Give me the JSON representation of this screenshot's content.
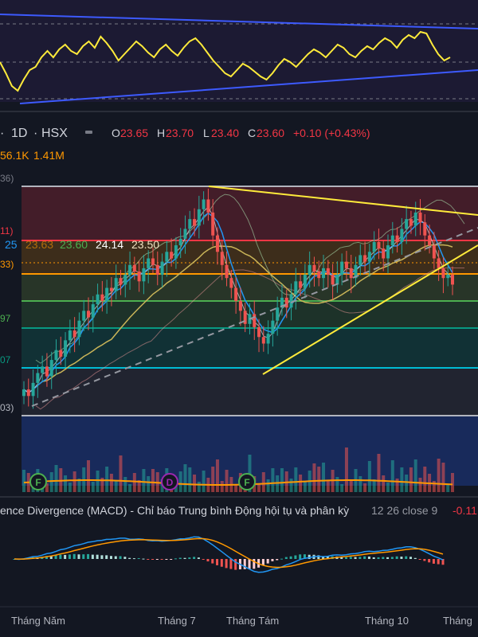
{
  "colors": {
    "background": "#131722",
    "rsi_line": "#ffeb3b",
    "trend_blue": "#3d5afe",
    "candle_up": "#26a69a",
    "candle_down": "#ef5350",
    "macd_line": "#2196f3",
    "signal_line": "#ff9800",
    "fib_top": "#b2b5be",
    "fib_red": "#f23645",
    "fib_orange": "#ff9800",
    "fib_yellow": "#ffeb3b",
    "fib_green": "#4caf50",
    "fib_teal": "#089981",
    "fib_cyan": "#00bcd4"
  },
  "header": {
    "interval": "1D",
    "exchange": "HSX",
    "separator": "·",
    "o_label": "O",
    "o_value": "23.65",
    "h_label": "H",
    "h_value": "23.70",
    "l_label": "L",
    "l_value": "23.40",
    "c_label": "C",
    "c_value": "23.60",
    "change": "+0.10 (+0.43%)",
    "vol1": "56.1K",
    "vol2": "1.41M"
  },
  "ma_values": {
    "v1": "25",
    "v2": "23.63",
    "v3": "23.60",
    "v4": "24.14",
    "v5": "23.50"
  },
  "left_price_labels": {
    "p1": "36)",
    "p2": "11)",
    "p3": "33)",
    "p4": "97",
    "p5": "07",
    "p6": "03)"
  },
  "events": [
    "F",
    "D",
    "F"
  ],
  "macd_title": "ence Divergence (MACD) - Chỉ báo Trung bình Động hội tụ và phân kỳ",
  "macd_params": "12 26 close 9",
  "macd_value": "-0.11",
  "x_labels": [
    "Tháng Năm",
    "Tháng 7",
    "Tháng Tám",
    "Tháng 10",
    "Tháng"
  ],
  "chart_data": {
    "type": "candlestick",
    "title": "",
    "exchange": "HSX",
    "interval": "1D",
    "last_bar": {
      "open": 23.65,
      "high": 23.7,
      "low": 23.4,
      "close": 23.6,
      "change": 0.1,
      "change_pct": 0.43
    },
    "x_tick_labels": [
      "Tháng Năm",
      "Tháng 7",
      "Tháng Tám",
      "Tháng 10",
      "Tháng"
    ],
    "moving_averages": [
      23.63,
      23.6,
      24.14,
      23.5
    ],
    "fibonacci_levels": [
      "top",
      "red",
      "orange",
      "yellow",
      "green",
      "teal",
      "cyan",
      "bottom"
    ],
    "macd": {
      "fast": 12,
      "slow": 26,
      "source": "close",
      "signal": 9,
      "last_value": -0.11
    },
    "close_series": [
      20.4,
      20.2,
      20.6,
      20.9,
      21.1,
      20.8,
      21.3,
      21.6,
      21.4,
      21.9,
      22.2,
      22.0,
      22.5,
      22.8,
      22.6,
      23.0,
      23.3,
      23.1,
      23.5,
      23.4,
      23.8,
      23.6,
      23.9,
      24.2,
      24.0,
      23.7,
      24.1,
      24.4,
      24.2,
      23.9,
      24.3,
      24.6,
      24.4,
      24.8,
      25.0,
      25.3,
      25.6,
      25.4,
      25.9,
      26.2,
      25.8,
      25.1,
      24.6,
      24.2,
      23.8,
      23.5,
      23.1,
      22.8,
      22.4,
      22.7,
      22.3,
      22.0,
      21.8,
      22.1,
      22.5,
      22.9,
      23.2,
      22.9,
      23.3,
      23.7,
      23.5,
      23.9,
      24.2,
      24.0,
      23.8,
      24.1,
      23.9,
      23.6,
      23.9,
      24.3,
      24.1,
      23.8,
      24.2,
      24.5,
      24.3,
      24.6,
      24.9,
      24.7,
      24.4,
      24.8,
      25.1,
      24.9,
      25.3,
      25.6,
      25.4,
      25.8,
      25.5,
      25.1,
      24.8,
      24.4,
      24.1,
      23.8,
      23.9,
      23.6
    ],
    "rsi_series": [
      55,
      48,
      40,
      37,
      44,
      50,
      52,
      58,
      62,
      58,
      63,
      66,
      62,
      60,
      65,
      68,
      64,
      71,
      67,
      62,
      56,
      60,
      64,
      68,
      65,
      61,
      58,
      63,
      66,
      62,
      59,
      64,
      68,
      70,
      66,
      61,
      56,
      52,
      48,
      46,
      50,
      54,
      52,
      49,
      46,
      44,
      48,
      53,
      57,
      55,
      52,
      56,
      60,
      63,
      61,
      58,
      62,
      66,
      64,
      60,
      58,
      62,
      65,
      63,
      67,
      70,
      68,
      64,
      69,
      72,
      70,
      74,
      73,
      66,
      60,
      56,
      58
    ]
  }
}
